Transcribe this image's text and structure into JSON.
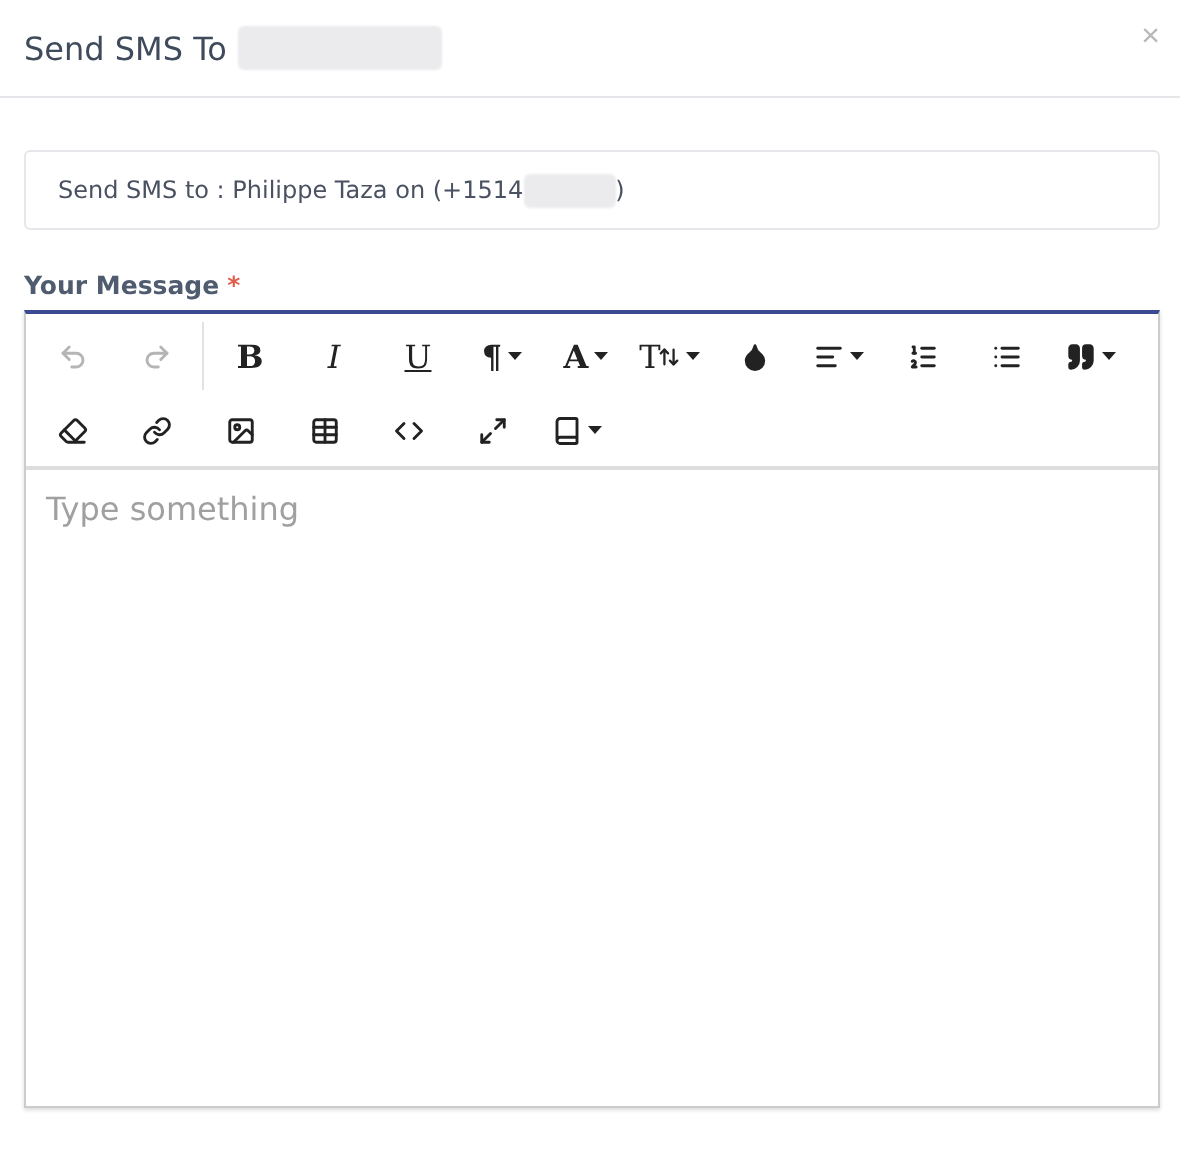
{
  "dialog": {
    "title": "Send SMS To",
    "title_redacted": true,
    "close": "×"
  },
  "recipient": {
    "text": "Send SMS to : Philippe Taza on (+1514",
    "redacted": true,
    "suffix": ")"
  },
  "message": {
    "label": "Your Message",
    "required": "*",
    "placeholder": "Type something"
  },
  "toolbar": [
    [
      {
        "kind": "undo",
        "disabled": true
      },
      {
        "kind": "redo",
        "disabled": true
      },
      {
        "kind": "bold",
        "label": "B"
      },
      {
        "kind": "italic",
        "label": "I"
      },
      {
        "kind": "underline",
        "label": "U"
      },
      {
        "kind": "paragraph",
        "label": "¶",
        "dropdown": true
      },
      {
        "kind": "font",
        "label": "A",
        "dropdown": true
      },
      {
        "kind": "size",
        "label": "T",
        "dropdown": true
      },
      {
        "kind": "color"
      },
      {
        "kind": "align",
        "dropdown": true
      },
      {
        "kind": "ordered"
      },
      {
        "kind": "bullets"
      },
      {
        "kind": "quote",
        "dropdown": true
      }
    ],
    [
      {
        "kind": "eraser"
      },
      {
        "kind": "link"
      },
      {
        "kind": "image"
      },
      {
        "kind": "table"
      },
      {
        "kind": "code"
      },
      {
        "kind": "expand"
      },
      {
        "kind": "book",
        "dropdown": true
      }
    ]
  ]
}
